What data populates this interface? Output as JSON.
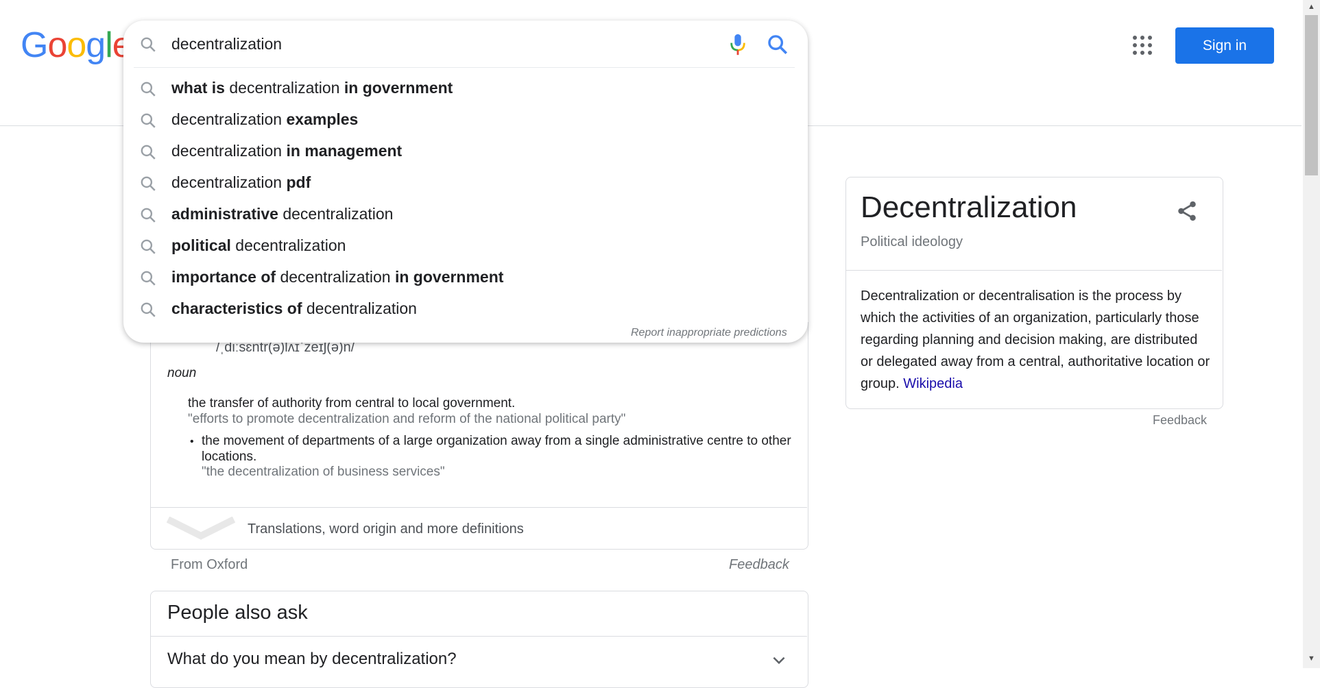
{
  "header": {
    "logo": {
      "letters": [
        "G",
        "o",
        "o",
        "g",
        "l",
        "e"
      ],
      "colors": [
        "#4285F4",
        "#EA4335",
        "#FBBC05",
        "#4285F4",
        "#34A853",
        "#EA4335"
      ]
    },
    "sign_in_label": "Sign in",
    "accent": "#1a73e8"
  },
  "search": {
    "query": "decentralization",
    "suggestions": [
      {
        "parts": [
          [
            "b",
            "what is"
          ],
          [
            "n",
            " decentralization "
          ],
          [
            "b",
            "in government"
          ]
        ]
      },
      {
        "parts": [
          [
            "n",
            "decentralization "
          ],
          [
            "b",
            "examples"
          ]
        ]
      },
      {
        "parts": [
          [
            "n",
            "decentralization "
          ],
          [
            "b",
            "in management"
          ]
        ]
      },
      {
        "parts": [
          [
            "n",
            "decentralization "
          ],
          [
            "b",
            "pdf"
          ]
        ]
      },
      {
        "parts": [
          [
            "b",
            "administrative"
          ],
          [
            "n",
            " decentralization"
          ]
        ]
      },
      {
        "parts": [
          [
            "b",
            "political"
          ],
          [
            "n",
            " decentralization"
          ]
        ]
      },
      {
        "parts": [
          [
            "b",
            "importance of"
          ],
          [
            "n",
            " decentralization "
          ],
          [
            "b",
            "in government"
          ]
        ]
      },
      {
        "parts": [
          [
            "b",
            "characteristics of"
          ],
          [
            "n",
            " decentralization"
          ]
        ]
      }
    ],
    "report_label": "Report inappropriate predictions"
  },
  "dictionary": {
    "phonetic": "/ˌdiːsɛntr(ə)lʌɪˈzeɪʃ(ə)n/",
    "pos": "noun",
    "definition_1": "the transfer of authority from central to local government.",
    "example_1": "\"efforts to promote decentralization and reform of the national political party\"",
    "definition_2": "the movement of departments of a large organization away from a single administrative centre to other locations.",
    "example_2": "\"the decentralization of business services\"",
    "more_label": "Translations, word origin and more definitions",
    "source": "From Oxford",
    "feedback": "Feedback"
  },
  "people_also_ask": {
    "title": "People also ask",
    "questions": [
      "What do you mean by decentralization?"
    ]
  },
  "knowledge_panel": {
    "title": "Decentralization",
    "subtitle": "Political ideology",
    "description": "Decentralization or decentralisation is the process by which the activities of an organization, particularly those regarding planning and decision making, are distributed or delegated away from a central, authoritative location or group. ",
    "source_link": "Wikipedia",
    "feedback": "Feedback"
  },
  "icons": [
    "search-icon",
    "microphone-icon",
    "apps-grid-icon",
    "share-icon",
    "chevron-down-icon"
  ]
}
